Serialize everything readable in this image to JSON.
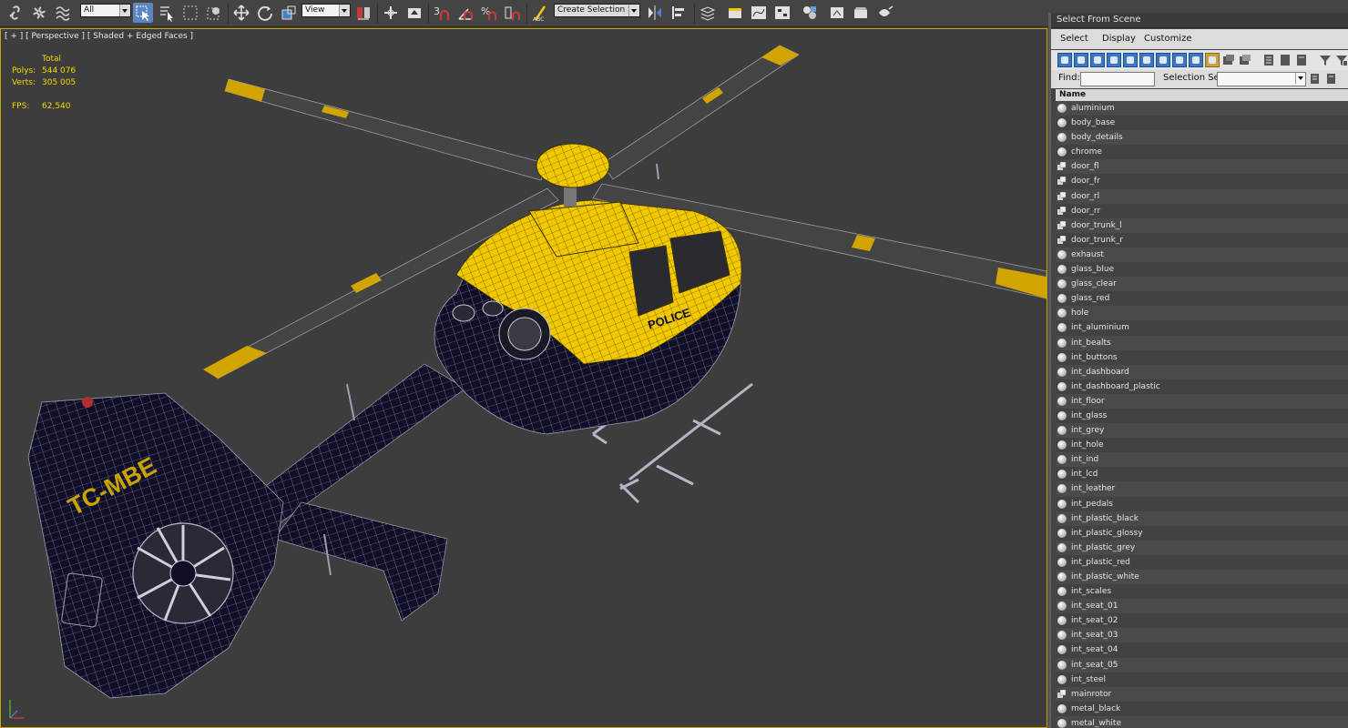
{
  "toolbar": {
    "selection_filter": "All",
    "reference_coord": "View",
    "named_selection_placeholder": "Create Selection Se",
    "snap_label": "3",
    "percent_label": "%"
  },
  "viewport": {
    "label": "[ + ] [ Perspective ] [ Shaded + Edged Faces ]",
    "stats": {
      "total_label": "Total",
      "polys_label": "Polys:",
      "polys_value": "544 076",
      "verts_label": "Verts:",
      "verts_value": "305 005",
      "fps_label": "FPS:",
      "fps_value": "62,540"
    },
    "registration": "TC-MBE",
    "colors": {
      "body": "#0f0f2a",
      "accent": "#f2c800",
      "grid": "#9e9eb0",
      "background": "#3d3d3d"
    }
  },
  "scene_panel": {
    "title": "Select From Scene",
    "menu": [
      "Select",
      "Display",
      "Customize"
    ],
    "find_label": "Find:",
    "find_value": "",
    "selection_set_label": "Selection Set:",
    "selection_set_value": "",
    "column_header": "Name",
    "items": [
      {
        "name": "aluminium",
        "type": "sphere"
      },
      {
        "name": "body_base",
        "type": "sphere"
      },
      {
        "name": "body_details",
        "type": "sphere"
      },
      {
        "name": "chrome",
        "type": "sphere"
      },
      {
        "name": "door_fl",
        "type": "group"
      },
      {
        "name": "door_fr",
        "type": "group"
      },
      {
        "name": "door_rl",
        "type": "group"
      },
      {
        "name": "door_rr",
        "type": "group"
      },
      {
        "name": "door_trunk_l",
        "type": "group"
      },
      {
        "name": "door_trunk_r",
        "type": "group"
      },
      {
        "name": "exhaust",
        "type": "sphere"
      },
      {
        "name": "glass_blue",
        "type": "sphere"
      },
      {
        "name": "glass_clear",
        "type": "sphere"
      },
      {
        "name": "glass_red",
        "type": "sphere"
      },
      {
        "name": "hole",
        "type": "sphere"
      },
      {
        "name": "int_aluminium",
        "type": "sphere"
      },
      {
        "name": "int_bealts",
        "type": "sphere"
      },
      {
        "name": "int_buttons",
        "type": "sphere"
      },
      {
        "name": "int_dashboard",
        "type": "sphere"
      },
      {
        "name": "int_dashboard_plastic",
        "type": "sphere"
      },
      {
        "name": "int_floor",
        "type": "sphere"
      },
      {
        "name": "int_glass",
        "type": "sphere"
      },
      {
        "name": "int_grey",
        "type": "sphere"
      },
      {
        "name": "int_hole",
        "type": "sphere"
      },
      {
        "name": "int_ind",
        "type": "sphere"
      },
      {
        "name": "int_lcd",
        "type": "sphere"
      },
      {
        "name": "int_leather",
        "type": "sphere"
      },
      {
        "name": "int_pedals",
        "type": "sphere"
      },
      {
        "name": "int_plastic_black",
        "type": "sphere"
      },
      {
        "name": "int_plastic_glossy",
        "type": "sphere"
      },
      {
        "name": "int_plastic_grey",
        "type": "sphere"
      },
      {
        "name": "int_plastic_red",
        "type": "sphere"
      },
      {
        "name": "int_plastic_white",
        "type": "sphere"
      },
      {
        "name": "int_scales",
        "type": "sphere"
      },
      {
        "name": "int_seat_01",
        "type": "sphere"
      },
      {
        "name": "int_seat_02",
        "type": "sphere"
      },
      {
        "name": "int_seat_03",
        "type": "sphere"
      },
      {
        "name": "int_seat_04",
        "type": "sphere"
      },
      {
        "name": "int_seat_05",
        "type": "sphere"
      },
      {
        "name": "int_steel",
        "type": "sphere"
      },
      {
        "name": "mainrotor",
        "type": "group"
      },
      {
        "name": "metal_black",
        "type": "sphere"
      },
      {
        "name": "metal_white",
        "type": "sphere"
      }
    ]
  }
}
